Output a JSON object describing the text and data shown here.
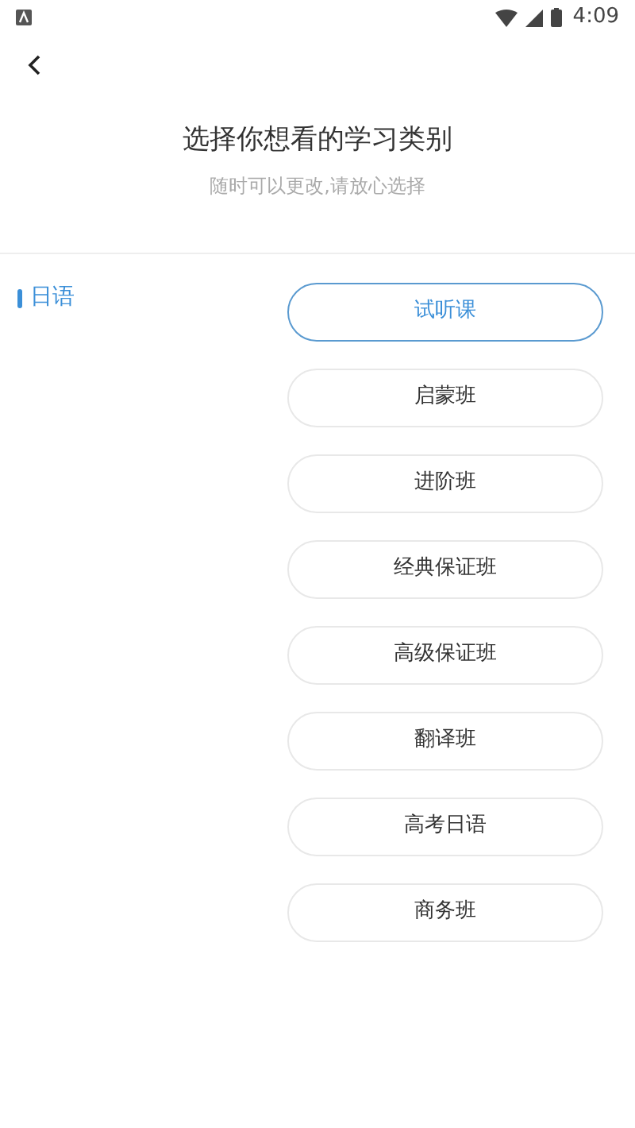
{
  "status_bar": {
    "time": "4:09"
  },
  "header": {
    "title": "选择你想看的学习类别",
    "subtitle": "随时可以更改,请放心选择"
  },
  "languages": [
    {
      "label": "日语",
      "selected": true
    }
  ],
  "categories": [
    {
      "label": "试听课",
      "selected": true
    },
    {
      "label": "启蒙班",
      "selected": false
    },
    {
      "label": "进阶班",
      "selected": false
    },
    {
      "label": "经典保证班",
      "selected": false
    },
    {
      "label": "高级保证班",
      "selected": false
    },
    {
      "label": "翻译班",
      "selected": false
    },
    {
      "label": "高考日语",
      "selected": false
    },
    {
      "label": "商务班",
      "selected": false
    }
  ]
}
